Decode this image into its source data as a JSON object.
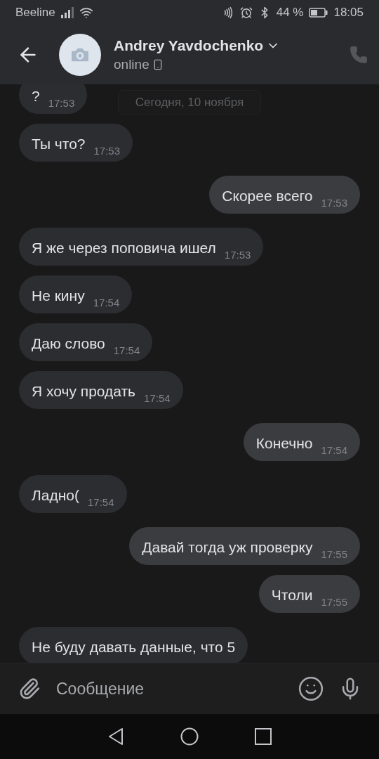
{
  "status_bar": {
    "carrier": "Beeline",
    "battery": "44 %",
    "time": "18:05"
  },
  "header": {
    "name": "Andrey Yavdochenko",
    "status": "online"
  },
  "date_divider": "Сегодня, 10 ноября",
  "messages": [
    {
      "outgoing": false,
      "text": "?",
      "time": "17:53"
    },
    {
      "outgoing": false,
      "text": "Ты что?",
      "time": "17:53"
    },
    {
      "outgoing": true,
      "text": "Скорее всего",
      "time": "17:53"
    },
    {
      "outgoing": false,
      "text": "Я же через поповича ишел",
      "time": "17:53"
    },
    {
      "outgoing": false,
      "text": "Не кину",
      "time": "17:54"
    },
    {
      "outgoing": false,
      "text": "Даю слово",
      "time": "17:54"
    },
    {
      "outgoing": false,
      "text": "Я хочу продать",
      "time": "17:54"
    },
    {
      "outgoing": true,
      "text": "Конечно",
      "time": "17:54"
    },
    {
      "outgoing": false,
      "text": "Ладно(",
      "time": "17:54"
    },
    {
      "outgoing": true,
      "text": "Давай тогда уж проверку",
      "time": "17:55"
    },
    {
      "outgoing": true,
      "text": "Чтоли",
      "time": "17:55"
    },
    {
      "outgoing": false,
      "text": "Не буду давать данные, что 5"
    }
  ],
  "composer": {
    "placeholder": "Сообщение"
  }
}
